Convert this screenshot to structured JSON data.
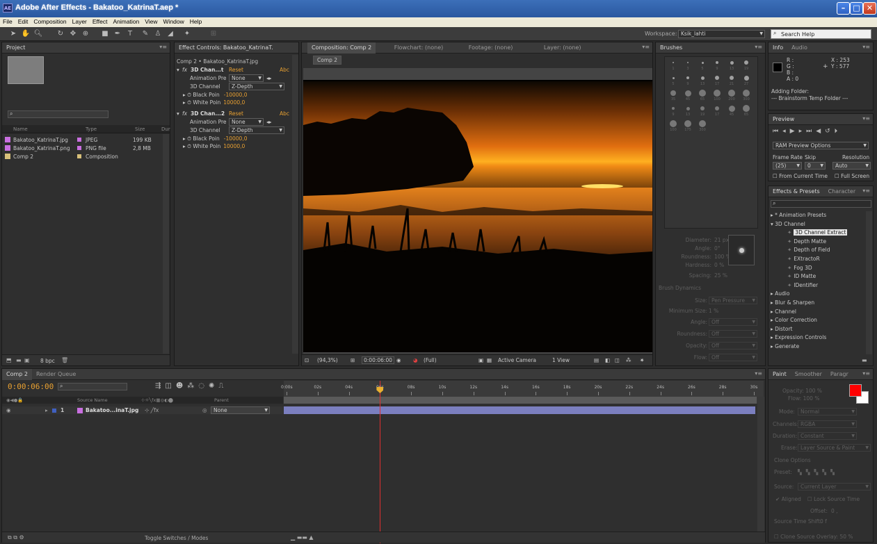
{
  "window": {
    "title": "Adobe After Effects - Bakatoo_KatrinaT.aep *",
    "app_icon": "AE"
  },
  "menu": [
    "File",
    "Edit",
    "Composition",
    "Layer",
    "Effect",
    "Animation",
    "View",
    "Window",
    "Help"
  ],
  "workspace": {
    "label": "Workspace:",
    "value": "Ksik_lahti",
    "search_placeholder": "Search Help"
  },
  "project": {
    "tab": "Project",
    "columns": {
      "name": "Name",
      "type": "Type",
      "size": "Size",
      "dur": "Dur"
    },
    "items": [
      {
        "name": "Bakatoo_KatrinaT.jpg",
        "type": "JPEG",
        "size": "199 KB",
        "color": "#c96fe0"
      },
      {
        "name": "Bakatoo_KatrinaT.png",
        "type": "PNG file",
        "size": "2,8 MB",
        "color": "#c96fe0"
      },
      {
        "name": "Comp 2",
        "type": "Composition",
        "size": "",
        "color": "#d8c07a"
      }
    ],
    "bpc": "8 bpc"
  },
  "effect_controls": {
    "tab": "Effect Controls: Bakatoo_KatrinaT.",
    "subtitle": "Comp 2 • Bakatoo_KatrinaT.jpg",
    "effects": [
      {
        "name": "3D Chan...t",
        "reset": "Reset",
        "abc": "Abc",
        "anim_label": "Animation Pre",
        "anim_value": "None",
        "channel_label": "3D Channel",
        "channel_value": "Z-Depth",
        "black_label": "Black Poin",
        "black_value": "-10000,0",
        "white_label": "White Poin",
        "white_value": "10000,0"
      },
      {
        "name": "3D Chan...2",
        "reset": "Reset",
        "abc": "Abc",
        "anim_label": "Animation Pre",
        "anim_value": "None",
        "channel_label": "3D Channel",
        "channel_value": "Z-Depth",
        "black_label": "Black Poin",
        "black_value": "-10000,0",
        "white_label": "White Poin",
        "white_value": "10000,0"
      }
    ]
  },
  "viewer": {
    "tabs": [
      "Composition: Comp 2",
      "Flowchart: (none)",
      "Footage: (none)",
      "Layer: (none)"
    ],
    "comp_tab": "Comp 2",
    "zoom": "(94,3%)",
    "timecode": "0:00:06:00",
    "resolution": "(Full)",
    "camera": "Active Camera",
    "view": "1 View"
  },
  "brushes": {
    "tab": "Brushes",
    "sizes": [
      "1",
      "3",
      "5",
      "9",
      "13",
      "19",
      "5",
      "9",
      "13",
      "17",
      "21",
      "27",
      "35",
      "45",
      "65",
      "100",
      "200",
      "300",
      "9",
      "13",
      "19",
      "17",
      "45",
      "65",
      "100",
      "175",
      "300"
    ],
    "diameter_label": "Diameter:",
    "diameter_value": "21 px",
    "angle_label": "Angle:",
    "angle_value": "0°",
    "roundness_label": "Roundness:",
    "roundness_value": "100 %",
    "hardness_label": "Hardness:",
    "hardness_value": "0 %",
    "spacing_label": "Spacing:",
    "spacing_value": "25 %",
    "dynamics_label": "Brush Dynamics",
    "size_label": "Size:",
    "size_value": "Pen Pressure",
    "min_size_label": "Minimum Size:",
    "min_size_value": "1 %",
    "angle2_label": "Angle:",
    "angle2_value": "Off",
    "roundness2_label": "Roundness:",
    "roundness2_value": "Off",
    "opacity_label": "Opacity:",
    "opacity_value": "Off",
    "flow_label": "Flow:",
    "flow_value": "Off"
  },
  "info": {
    "tabs": [
      "Info",
      "Audio"
    ],
    "r": "R :",
    "g": "G :",
    "b": "B :",
    "a": "A : 0",
    "x": "X : 253",
    "y": "Y : 577",
    "msg1": "Adding Folder:",
    "msg2": "--- Brainstorm Temp Folder ---"
  },
  "preview": {
    "tab": "Preview",
    "ram_options": "RAM Preview Options",
    "frame_rate_label": "Frame Rate",
    "skip_label": "Skip",
    "resolution_label": "Resolution",
    "frame_rate_value": "(25)",
    "skip_value": "0",
    "resolution_value": "Auto",
    "from_current": "From Current Time",
    "full_screen": "Full Screen"
  },
  "effects_presets": {
    "tabs": [
      "Effects & Presets",
      "Character"
    ],
    "items": [
      {
        "label": "▸ * Animation Presets",
        "indent": 0,
        "sel": false
      },
      {
        "label": "▾ 3D Channel",
        "indent": 0,
        "sel": false
      },
      {
        "label": "3D Channel Extract",
        "indent": 2,
        "sel": true
      },
      {
        "label": "Depth Matte",
        "indent": 2,
        "sel": false
      },
      {
        "label": "Depth of Field",
        "indent": 2,
        "sel": false
      },
      {
        "label": "EXtractoR",
        "indent": 2,
        "sel": false
      },
      {
        "label": "Fog 3D",
        "indent": 2,
        "sel": false
      },
      {
        "label": "ID Matte",
        "indent": 2,
        "sel": false
      },
      {
        "label": "IDentifier",
        "indent": 2,
        "sel": false
      },
      {
        "label": "▸ Audio",
        "indent": 0,
        "sel": false
      },
      {
        "label": "▸ Blur & Sharpen",
        "indent": 0,
        "sel": false
      },
      {
        "label": "▸ Channel",
        "indent": 0,
        "sel": false
      },
      {
        "label": "▸ Color Correction",
        "indent": 0,
        "sel": false
      },
      {
        "label": "▸ Distort",
        "indent": 0,
        "sel": false
      },
      {
        "label": "▸ Expression Controls",
        "indent": 0,
        "sel": false
      },
      {
        "label": "▸ Generate",
        "indent": 0,
        "sel": false
      }
    ]
  },
  "timeline": {
    "tabs": [
      "Comp 2",
      "Render Queue"
    ],
    "timecode": "0:00:06:00",
    "col_source": "Source Name",
    "col_parent": "Parent",
    "layer_num": "1",
    "layer_name": "Bakatoo...inaT.jpg",
    "layer_parent": "None",
    "ruler": [
      "0:00s",
      "02s",
      "04s",
      "06s",
      "08s",
      "10s",
      "12s",
      "14s",
      "16s",
      "18s",
      "20s",
      "22s",
      "24s",
      "26s",
      "28s",
      "30s"
    ],
    "toggle_label": "Toggle Switches / Modes",
    "current_time_fraction": 0.2
  },
  "paint": {
    "tabs": [
      "Paint",
      "Smoother",
      "Paragr"
    ],
    "opacity": "Opacity: 100 %",
    "flow": "Flow: 100 %",
    "mode_label": "Mode:",
    "mode_value": "Normal",
    "channels_label": "Channels:",
    "channels_value": "RGBA",
    "duration_label": "Duration:",
    "duration_value": "Constant",
    "erase_label": "Erase:",
    "erase_value": "Layer Source & Paint",
    "clone_options": "Clone Options",
    "preset_label": "Preset:",
    "source_label": "Source:",
    "source_value": "Current Layer",
    "aligned": "Aligned",
    "lock_source": "Lock Source Time",
    "offset_label": "Offset:",
    "offset_value": "0 ,",
    "shift_label": "Source Time Shift:",
    "shift_value": "0 f",
    "overlay": "Clone Source Overlay:",
    "overlay_value": "50 %",
    "fg_color": "#ff0000",
    "bg_color": "#ffffff"
  }
}
